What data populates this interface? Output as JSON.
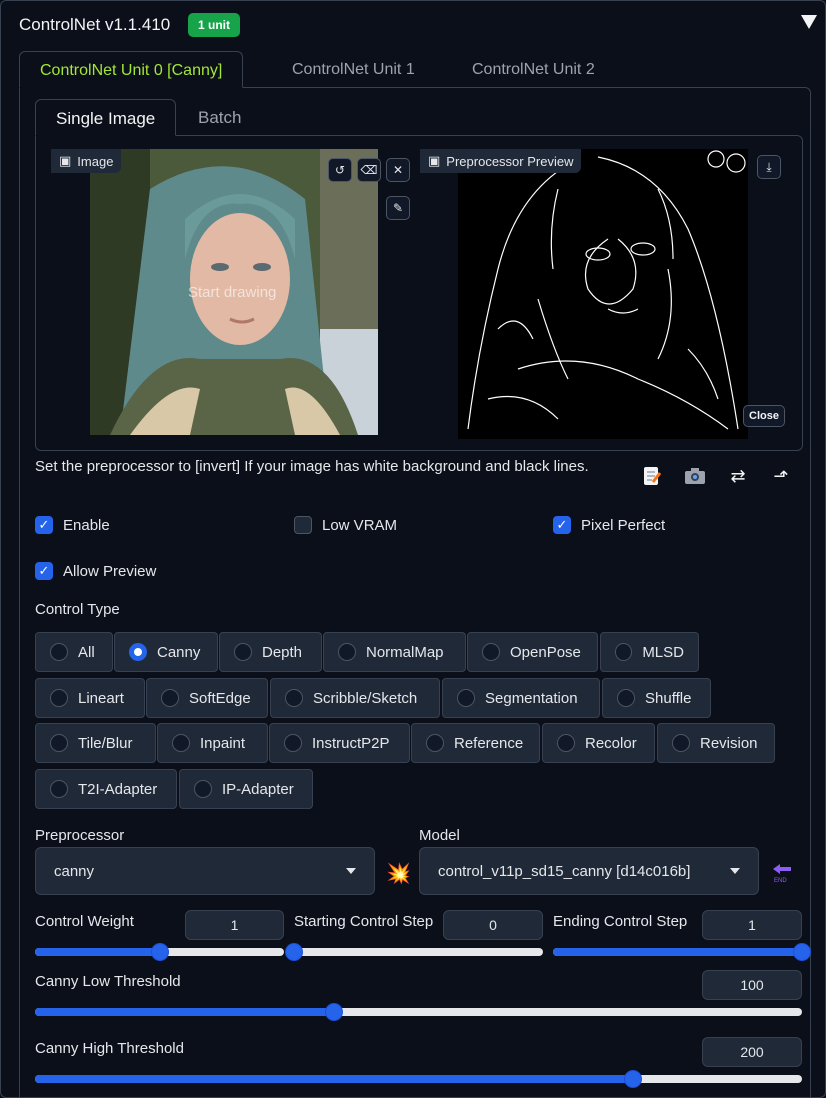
{
  "header": {
    "title": "ControlNet v1.1.410",
    "badge": "1 unit"
  },
  "unit_tabs": [
    "ControlNet Unit 0 [Canny]",
    "ControlNet Unit 1",
    "ControlNet Unit 2"
  ],
  "image_tabs": [
    "Single Image",
    "Batch"
  ],
  "image_panel": {
    "image_label": "Image",
    "start_drawing": "Start drawing",
    "preview_label": "Preprocessor Preview",
    "close_label": "Close"
  },
  "hint": "Set the preprocessor to [invert] If your image has white background and black lines.",
  "checkboxes": {
    "enable": {
      "label": "Enable",
      "checked": true
    },
    "low_vram": {
      "label": "Low VRAM",
      "checked": false
    },
    "pixel_perfect": {
      "label": "Pixel Perfect",
      "checked": true
    },
    "allow_preview": {
      "label": "Allow Preview",
      "checked": true
    }
  },
  "control_type": {
    "label": "Control Type",
    "selected": "Canny",
    "rows": [
      [
        "All",
        "Canny",
        "Depth",
        "NormalMap",
        "OpenPose",
        "MLSD"
      ],
      [
        "Lineart",
        "SoftEdge",
        "Scribble/Sketch",
        "Segmentation",
        "Shuffle"
      ],
      [
        "Tile/Blur",
        "Inpaint",
        "InstructP2P",
        "Reference",
        "Recolor",
        "Revision"
      ],
      [
        "T2I-Adapter",
        "IP-Adapter"
      ]
    ]
  },
  "preprocessor": {
    "label": "Preprocessor",
    "value": "canny"
  },
  "model": {
    "label": "Model",
    "value": "control_v11p_sd15_canny [d14c016b]"
  },
  "sliders": {
    "control_weight": {
      "label": "Control Weight",
      "value": "1",
      "fraction": 0.5
    },
    "starting_step": {
      "label": "Starting Control Step",
      "value": "0",
      "fraction": 0.0
    },
    "ending_step": {
      "label": "Ending Control Step",
      "value": "1",
      "fraction": 1.0
    },
    "canny_low": {
      "label": "Canny Low Threshold",
      "value": "100",
      "fraction": 0.39
    },
    "canny_high": {
      "label": "Canny High Threshold",
      "value": "200",
      "fraction": 0.78
    }
  },
  "colors": {
    "accent": "#2563eb",
    "active_tab": "#a3e635",
    "badge": "#16a34a"
  }
}
